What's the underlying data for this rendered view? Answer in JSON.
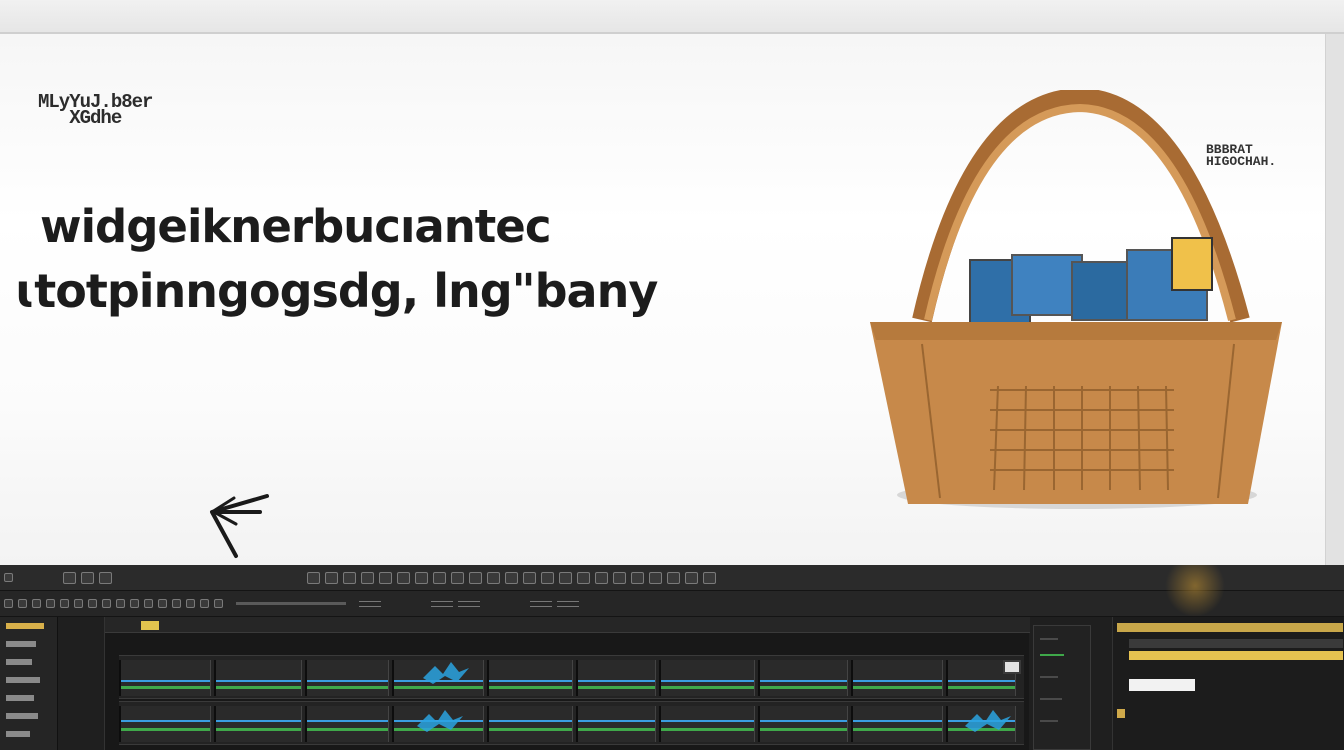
{
  "canvas": {
    "label_top": "MLyYuJ.b8er\n   XGdhe",
    "label_right": "BBBRAT\nHIGOCHAH.",
    "headline_line1": "widgeiknerbucıantec",
    "headline_line2": "ɩtotpinngogsdg, lng\"bany"
  },
  "icons": {
    "cursor": "cursor-arrow-icon",
    "basket": "shopping-basket-illustration",
    "buttons": "toolbar-button-icon"
  },
  "colors": {
    "basket": "#c58a4a",
    "editor_bg": "#1f1f1f",
    "audio_green": "#3fa84a",
    "audio_blue": "#3a9de0",
    "highlight_yellow": "#e2c34e"
  }
}
